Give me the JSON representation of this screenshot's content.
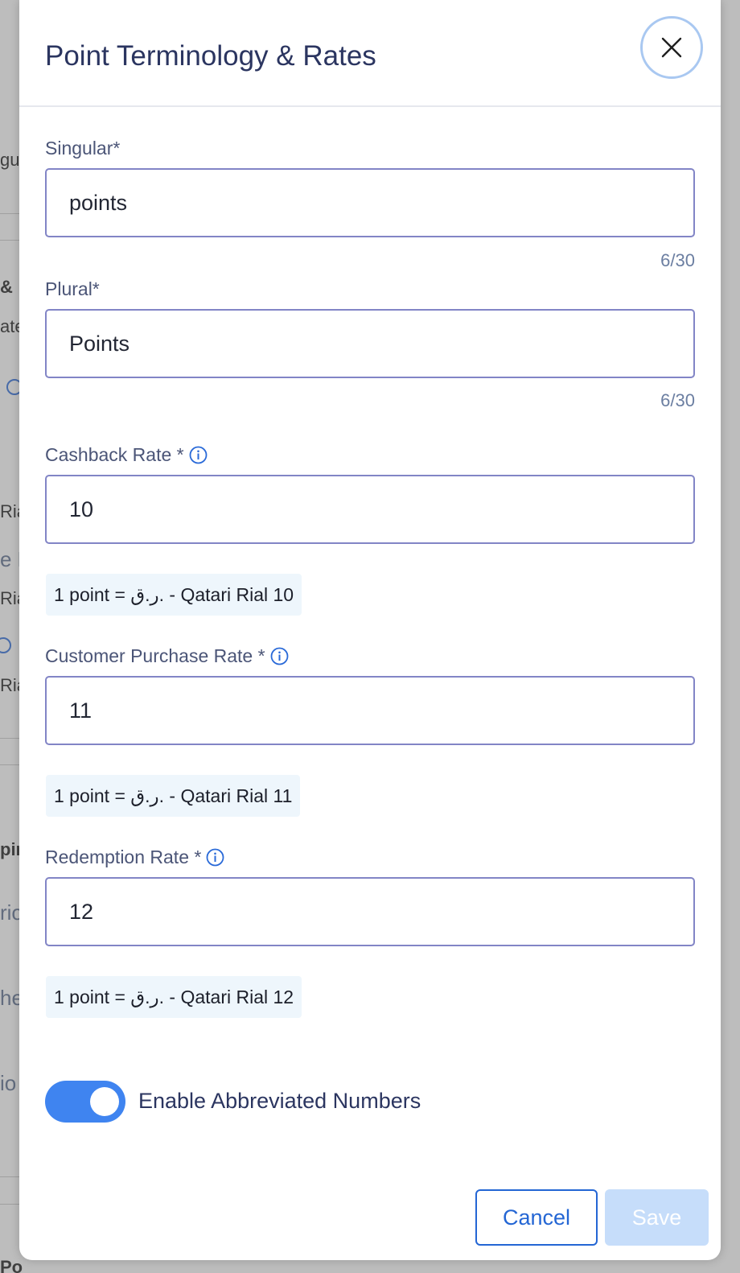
{
  "background": {
    "fragments": [
      "gu",
      "&",
      "ate",
      "Ria",
      "e L",
      "Ria",
      "Ria",
      "pir",
      "rio",
      "he",
      "io",
      "Po"
    ]
  },
  "modal": {
    "title": "Point Terminology & Rates",
    "close_icon": "close-icon"
  },
  "fields": {
    "singular": {
      "label": "Singular*",
      "value": "points",
      "counter": "6/30"
    },
    "plural": {
      "label": "Plural*",
      "value": "Points",
      "counter": "6/30"
    },
    "cashback_rate": {
      "label": "Cashback Rate *",
      "value": "10",
      "conversion": "1 point = ر.ق. - Qatari Rial 10"
    },
    "purchase_rate": {
      "label": "Customer Purchase Rate *",
      "value": "11",
      "conversion": "1 point = ر.ق. - Qatari Rial 11"
    },
    "redemption_rate": {
      "label": "Redemption Rate *",
      "value": "12",
      "conversion": "1 point = ر.ق. - Qatari Rial 12"
    }
  },
  "toggle": {
    "label": "Enable Abbreviated Numbers",
    "enabled": true
  },
  "actions": {
    "cancel_label": "Cancel",
    "save_label": "Save"
  },
  "colors": {
    "accent": "#2466d4",
    "toggle_on": "#3f84f0",
    "save_disabled": "#c6ddfa",
    "input_border": "#8285c6"
  }
}
